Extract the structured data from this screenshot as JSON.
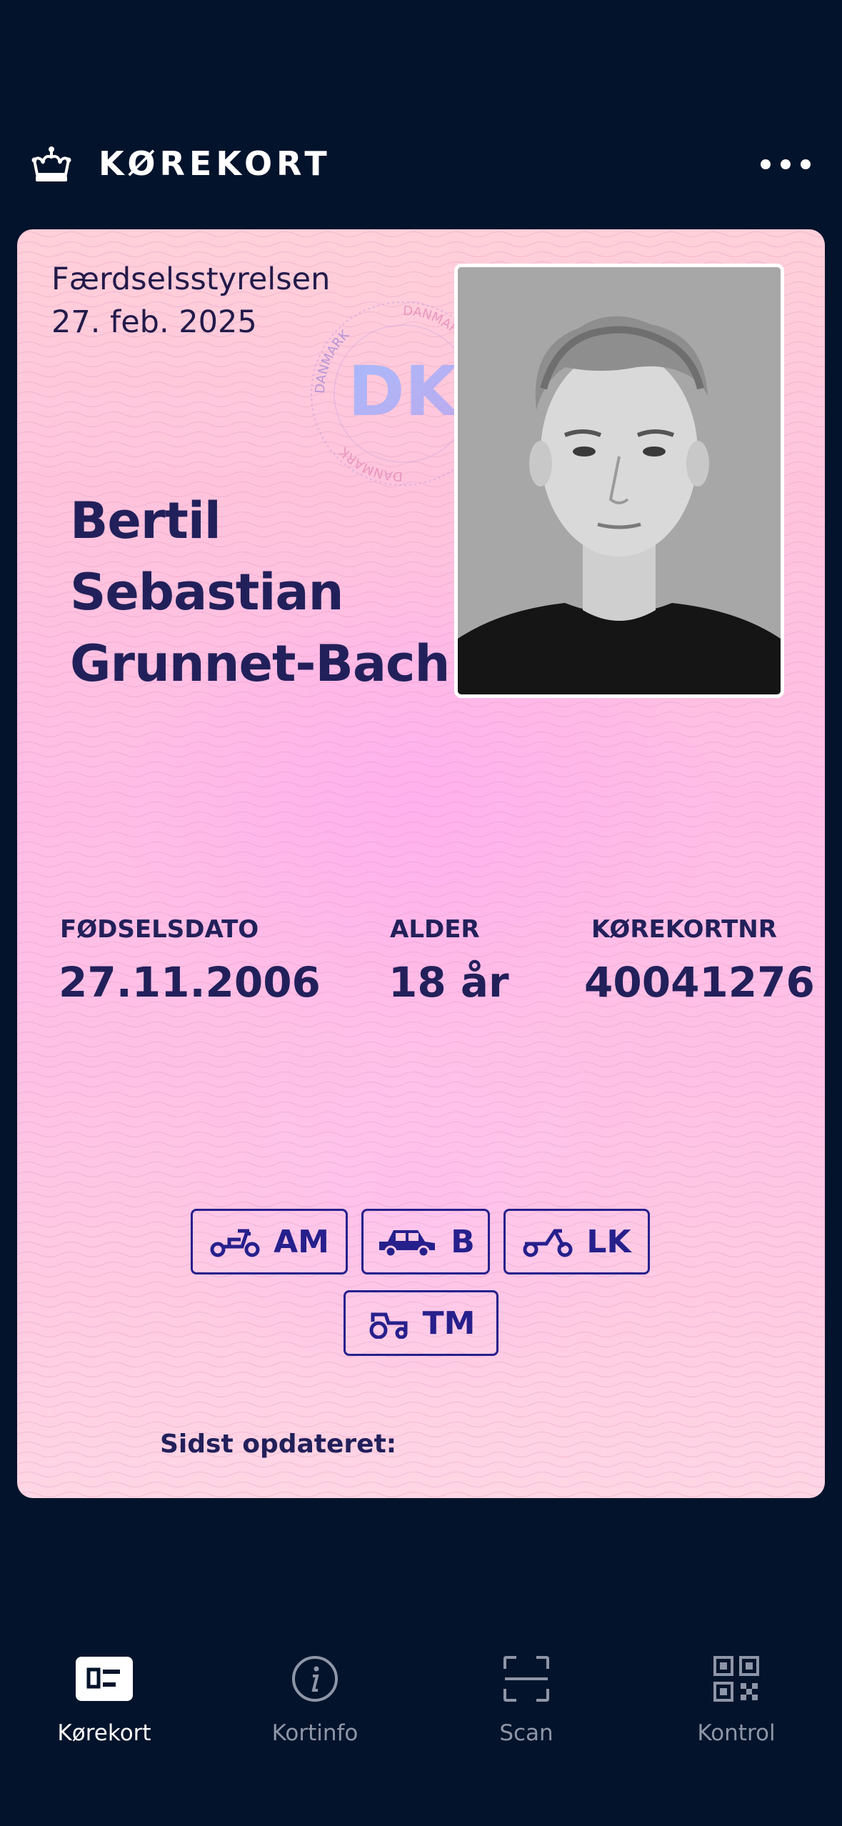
{
  "header": {
    "title": "KØREKORT"
  },
  "card": {
    "issuer": "Færdselsstyrelsen",
    "issue_date": "27. feb. 2025",
    "seal_letters": "DK",
    "seal_ring_text": "DANMARK",
    "name_lines": [
      "Bertil",
      "Sebastian",
      "Grunnet-Bach"
    ],
    "fields": {
      "birthdate_label": "FØDSELSDATO",
      "birthdate_value": "27.11.2006",
      "age_label": "ALDER",
      "age_value": "18 år",
      "license_label": "KØREKORTNR",
      "license_value": "40041276"
    },
    "categories": [
      {
        "code": "AM",
        "icon": "moped-icon"
      },
      {
        "code": "B",
        "icon": "car-icon"
      },
      {
        "code": "LK",
        "icon": "scooter-icon"
      },
      {
        "code": "TM",
        "icon": "tractor-icon"
      }
    ],
    "updated_label": "Sidst opdateret:"
  },
  "nav": {
    "items": [
      {
        "label": "Kørekort",
        "icon": "id-card-icon",
        "active": true
      },
      {
        "label": "Kortinfo",
        "icon": "info-icon",
        "active": false
      },
      {
        "label": "Scan",
        "icon": "scan-icon",
        "active": false
      },
      {
        "label": "Kontrol",
        "icon": "qr-code-icon",
        "active": false
      }
    ]
  },
  "colors": {
    "background": "#03132b",
    "card_text": "#22205a",
    "category_border": "#26208c",
    "nav_inactive": "#8d96a8"
  }
}
